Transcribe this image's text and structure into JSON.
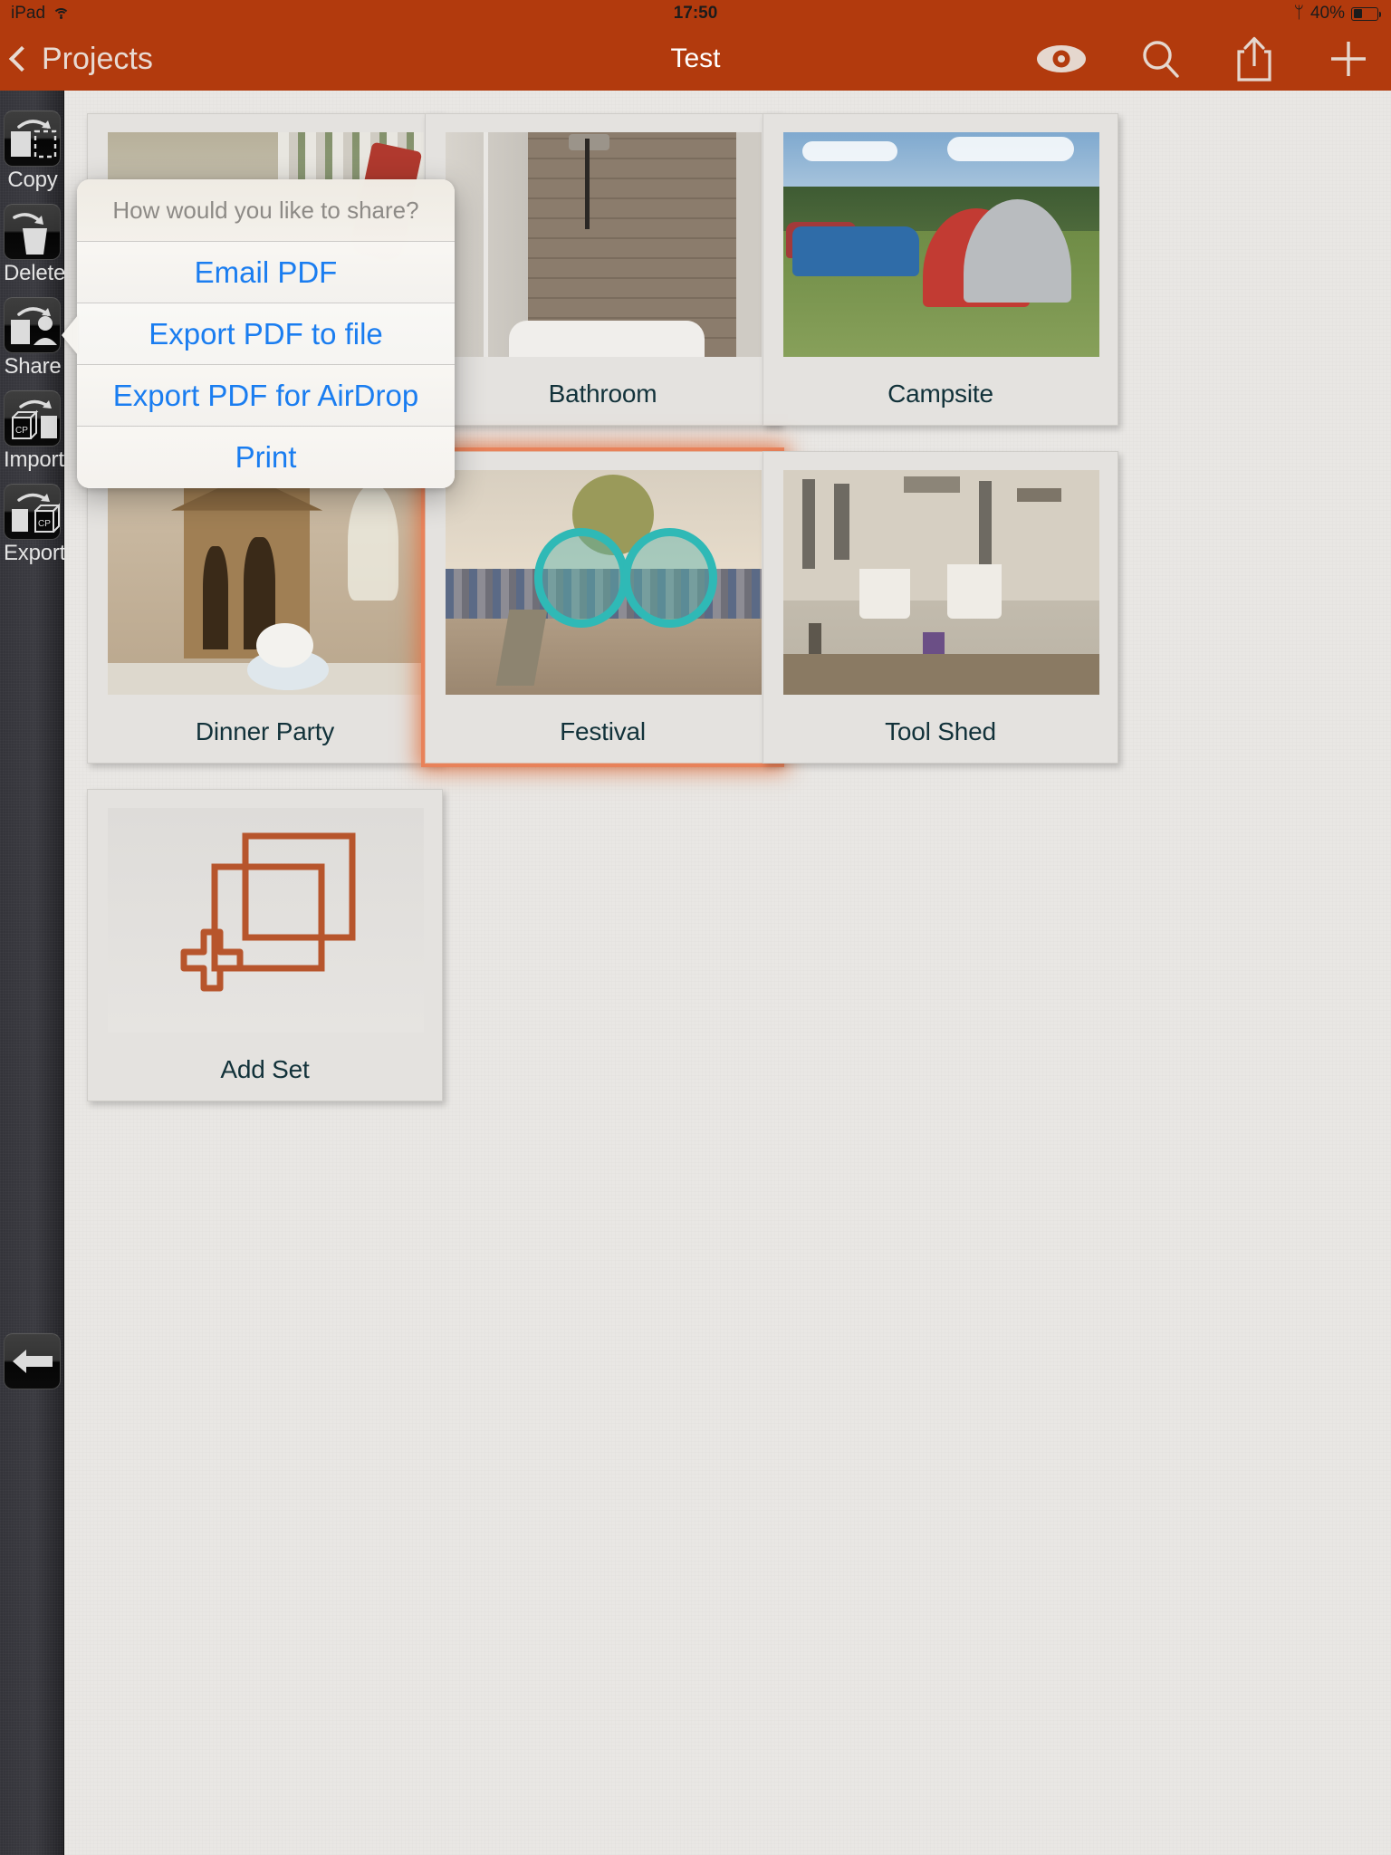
{
  "status_bar": {
    "device": "iPad",
    "wifi_icon": "wifi-icon",
    "time": "17:50",
    "bluetooth_icon": "bluetooth-icon",
    "battery_percent": "40%",
    "battery_level": 40
  },
  "nav_bar": {
    "back_label": "Projects",
    "title": "Test",
    "bar_color": "#b23a0d",
    "icons": [
      {
        "name": "eye-icon",
        "label": "Preview"
      },
      {
        "name": "search-icon",
        "label": "Search"
      },
      {
        "name": "share-icon",
        "label": "Share"
      },
      {
        "name": "plus-icon",
        "label": "Add"
      }
    ]
  },
  "sidebar": {
    "tools": [
      {
        "label": "Copy",
        "icon": "copy-icon"
      },
      {
        "label": "Delete",
        "icon": "trash-icon"
      },
      {
        "label": "Share",
        "icon": "share-person-icon"
      },
      {
        "label": "Import",
        "icon": "import-box-icon"
      },
      {
        "label": "Export",
        "icon": "export-box-icon"
      }
    ],
    "box_label": "CP",
    "back_button": {
      "name": "back-arrow-button",
      "icon": "arrow-left-icon"
    }
  },
  "popover": {
    "title": "How would you like to share?",
    "accent_color": "#1a7df0",
    "items": [
      {
        "label": "Email PDF",
        "highlighted": false
      },
      {
        "label": "Export PDF to file",
        "highlighted": true
      },
      {
        "label": "Export PDF for AirDrop",
        "highlighted": false
      },
      {
        "label": "Print",
        "highlighted": false
      }
    ]
  },
  "grid": {
    "cards": [
      {
        "caption": "",
        "selected": false,
        "art": "hose",
        "hidden_caption": true
      },
      {
        "caption": "Bathroom",
        "selected": false,
        "art": "bathroom"
      },
      {
        "caption": "Campsite",
        "selected": false,
        "art": "campsite"
      },
      {
        "caption": "Dinner Party",
        "selected": false,
        "art": "dinner"
      },
      {
        "caption": "Festival",
        "selected": true,
        "art": "festival"
      },
      {
        "caption": "Tool Shed",
        "selected": false,
        "art": "toolshed"
      },
      {
        "caption": "Add Set",
        "selected": false,
        "art": "addset"
      }
    ],
    "selection_color": "#e0703e",
    "caption_color": "#12323a"
  }
}
